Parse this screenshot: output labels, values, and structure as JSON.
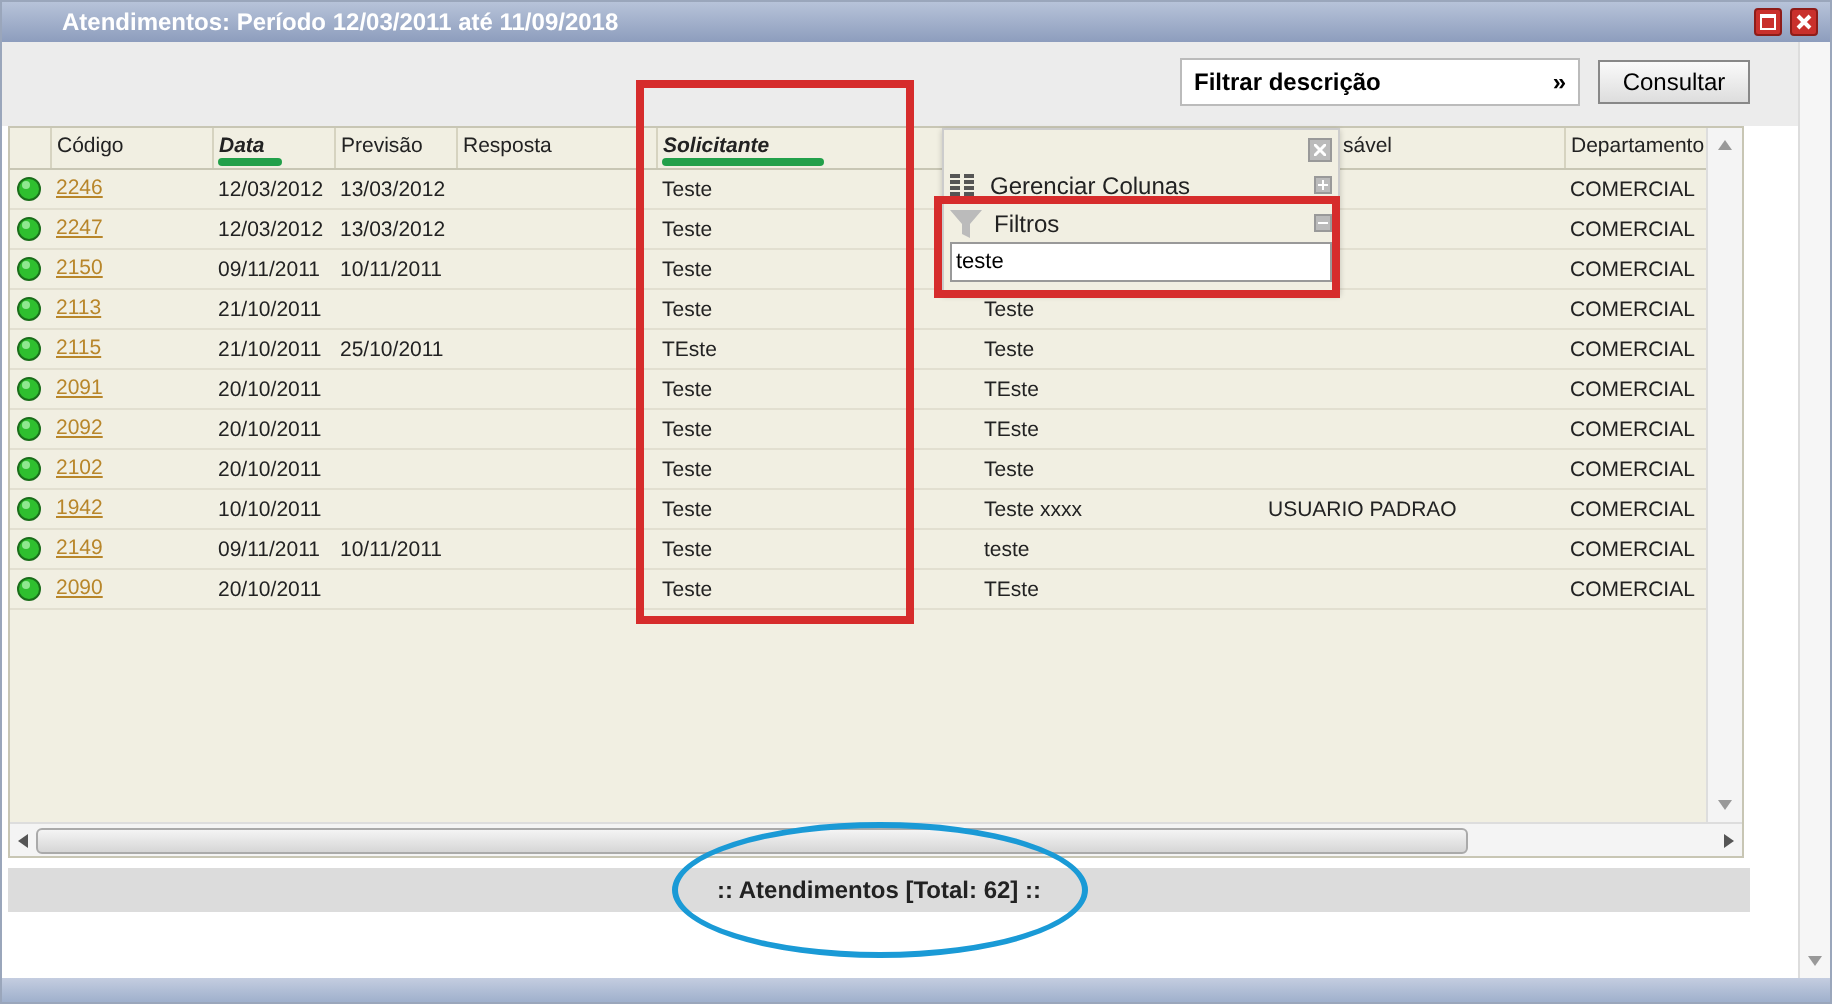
{
  "window": {
    "title": "Atendimentos: Período 12/03/2011 até 11/09/2018"
  },
  "toolbar": {
    "filter_button": {
      "label": "Filtrar descrição",
      "arrow": "»"
    },
    "search_button": "Consultar"
  },
  "table": {
    "columns": [
      {
        "label": "Código",
        "emphasized": false,
        "underlined": false,
        "boxed": false
      },
      {
        "label": "Data",
        "emphasized": true,
        "underlined": true,
        "boxed": false
      },
      {
        "label": "Previsão",
        "emphasized": false,
        "underlined": false,
        "boxed": false
      },
      {
        "label": "Resposta",
        "emphasized": false,
        "underlined": false,
        "boxed": false
      },
      {
        "label": "Solicitante",
        "emphasized": true,
        "underlined": true,
        "boxed": true
      },
      {},
      {
        "label": "sável",
        "emphasized": false,
        "underlined": false,
        "boxed": false
      },
      {
        "label": "Departamento",
        "emphasized": false,
        "underlined": false,
        "boxed": false
      }
    ],
    "rows": [
      {
        "cells": [
          "2246",
          "12/03/2012",
          "13/03/2012",
          null,
          "Teste",
          null,
          null,
          "COMERCIAL"
        ]
      },
      {
        "cells": [
          "2247",
          "12/03/2012",
          "13/03/2012",
          null,
          "Teste",
          null,
          null,
          "COMERCIAL"
        ]
      },
      {
        "cells": [
          "2150",
          "09/11/2011",
          "10/11/2011",
          null,
          "Teste",
          null,
          null,
          "COMERCIAL"
        ]
      },
      {
        "cells": [
          "2113",
          "21/10/2011",
          null,
          null,
          "Teste",
          "Teste",
          null,
          "COMERCIAL"
        ]
      },
      {
        "cells": [
          "2115",
          "21/10/2011",
          "25/10/2011",
          null,
          "TEste",
          "Teste",
          null,
          "COMERCIAL"
        ]
      },
      {
        "cells": [
          "2091",
          "20/10/2011",
          null,
          null,
          "Teste",
          "TEste",
          null,
          "COMERCIAL"
        ]
      },
      {
        "cells": [
          "2092",
          "20/10/2011",
          null,
          null,
          "Teste",
          "TEste",
          null,
          "COMERCIAL"
        ]
      },
      {
        "cells": [
          "2102",
          "20/10/2011",
          null,
          null,
          "Teste",
          "Teste",
          null,
          "COMERCIAL"
        ]
      },
      {
        "cells": [
          "1942",
          "10/10/2011",
          null,
          null,
          "Teste",
          "Teste xxxx",
          "USUARIO PADRAO",
          "COMERCIAL"
        ]
      },
      {
        "cells": [
          "2149",
          "09/11/2011",
          "10/11/2011",
          null,
          "Teste",
          "teste",
          null,
          "COMERCIAL"
        ]
      },
      {
        "cells": [
          "2090",
          "20/10/2011",
          null,
          null,
          "Teste",
          "TEste",
          null,
          "COMERCIAL"
        ]
      }
    ]
  },
  "column_menu": {
    "boxed": true,
    "items": [
      {
        "kind": "columns",
        "label": "Gerenciar Colunas",
        "expanded": false
      },
      {
        "kind": "filter",
        "label": "Filtros",
        "expanded": true,
        "value": "teste"
      }
    ]
  },
  "footer": {
    "text": ":: Atendimentos [Total: 62] ::",
    "circled": true
  }
}
